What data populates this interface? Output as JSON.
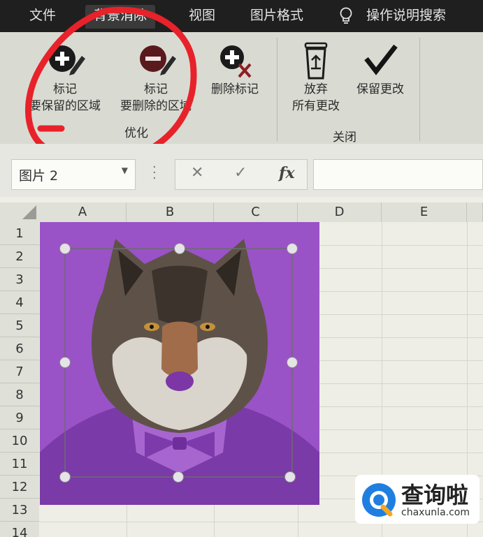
{
  "tabs": [
    "文件",
    "背景消除",
    "视图",
    "图片格式"
  ],
  "search": "操作说明搜索",
  "ribbon": {
    "mark_keep": [
      "标记",
      "要保留的区域"
    ],
    "mark_remove": [
      "标记",
      "要删除的区域"
    ],
    "delete_mark": "删除标记",
    "discard": [
      "放弃",
      "所有更改"
    ],
    "keep_changes": "保留更改",
    "group_refine": "优化",
    "group_close": "关闭"
  },
  "formula_bar": {
    "name_box": "图片 2",
    "cancel_glyph": "✕",
    "enter_glyph": "✓",
    "fx_glyph": "fx"
  },
  "sheet": {
    "columns": [
      "A",
      "B",
      "C",
      "D",
      "E"
    ],
    "rows": [
      "1",
      "2",
      "3",
      "4",
      "5",
      "6",
      "7",
      "8",
      "9",
      "10",
      "11",
      "12",
      "13",
      "14"
    ]
  },
  "watermark": {
    "title": "查询啦",
    "url": "chaxunla.com"
  },
  "colors": {
    "annotation": "#e8222a",
    "picture_bg": "#9a52c7"
  }
}
